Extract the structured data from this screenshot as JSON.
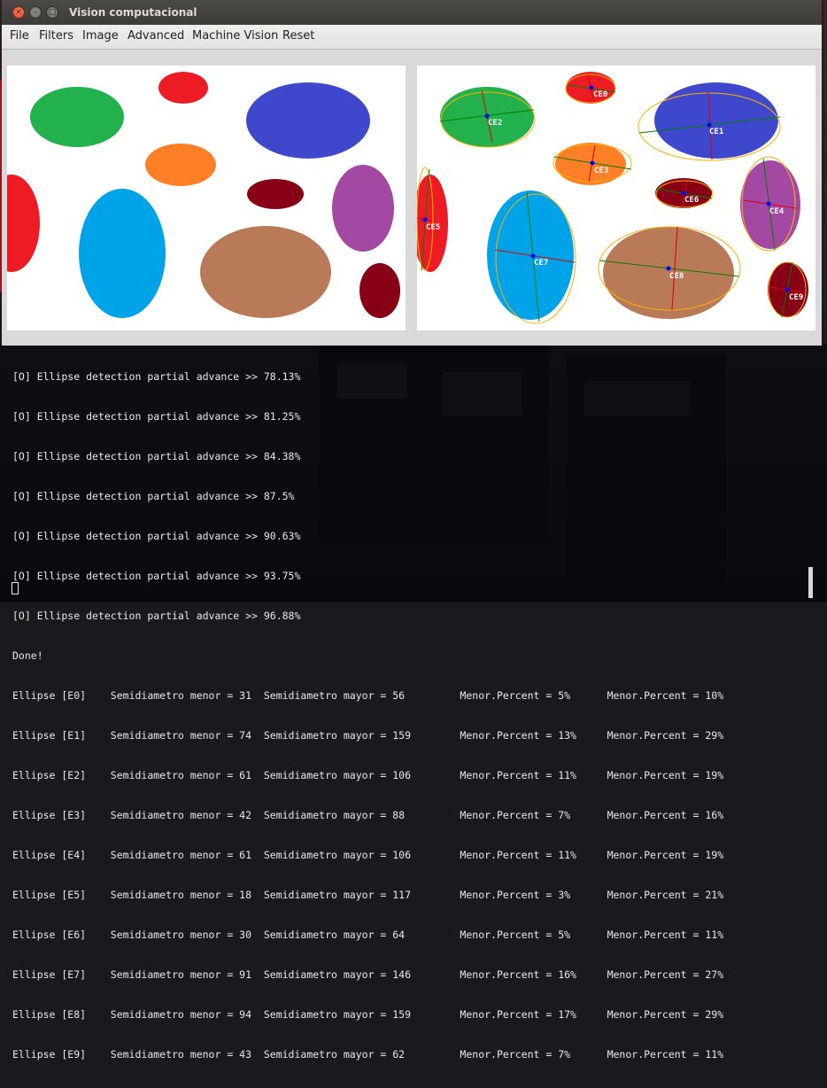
{
  "window": {
    "title": "Vision computacional",
    "controls": {
      "close": "×",
      "minimize": "–",
      "maximize": "□"
    }
  },
  "menu": [
    "File",
    "Filters",
    "Image",
    "Advanced",
    "Machine Vision",
    "Reset"
  ],
  "colors": {
    "green": "#22b14c",
    "red": "#ed1c24",
    "blue": "#3f48cc",
    "orange": "#ff7f27",
    "darkred": "#880015",
    "purple": "#a349a4",
    "lightblue": "#00a2e8",
    "brown": "#b97a57",
    "axis_green": "#008000",
    "axis_red": "#e00000",
    "center": "#0000ff",
    "fit_outline": "#ffb000"
  },
  "detected_labels": [
    "CE0",
    "CE1",
    "CE2",
    "CE3",
    "CE4",
    "CE5",
    "CE6",
    "CE7",
    "CE8",
    "CE9"
  ],
  "terminal": {
    "lines": [
      "[O] Ellipse detection partial advance >> 78.13%",
      "[O] Ellipse detection partial advance >> 81.25%",
      "[O] Ellipse detection partial advance >> 84.38%",
      "[O] Ellipse detection partial advance >> 87.5%",
      "[O] Ellipse detection partial advance >> 90.63%",
      "[O] Ellipse detection partial advance >> 93.75%",
      "[O] Ellipse detection partial advance >> 96.88%",
      "Done!",
      "Ellipse [E0]    Semidiametro menor = 31  Semidiametro mayor = 56         Menor.Percent = 5%      Menor.Percent = 10%",
      "Ellipse [E1]    Semidiametro menor = 74  Semidiametro mayor = 159        Menor.Percent = 13%     Menor.Percent = 29%",
      "Ellipse [E2]    Semidiametro menor = 61  Semidiametro mayor = 106        Menor.Percent = 11%     Menor.Percent = 19%",
      "Ellipse [E3]    Semidiametro menor = 42  Semidiametro mayor = 88         Menor.Percent = 7%      Menor.Percent = 16%",
      "Ellipse [E4]    Semidiametro menor = 61  Semidiametro mayor = 106        Menor.Percent = 11%     Menor.Percent = 19%",
      "Ellipse [E5]    Semidiametro menor = 18  Semidiametro mayor = 117        Menor.Percent = 3%      Menor.Percent = 21%",
      "Ellipse [E6]    Semidiametro menor = 30  Semidiametro mayor = 64         Menor.Percent = 5%      Menor.Percent = 11%",
      "Ellipse [E7]    Semidiametro menor = 91  Semidiametro mayor = 146        Menor.Percent = 16%     Menor.Percent = 27%",
      "Ellipse [E8]    Semidiametro menor = 94  Semidiametro mayor = 159        Menor.Percent = 17%     Menor.Percent = 29%",
      "Ellipse [E9]    Semidiametro menor = 43  Semidiametro mayor = 62         Menor.Percent = 7%      Menor.Percent = 11%"
    ]
  }
}
